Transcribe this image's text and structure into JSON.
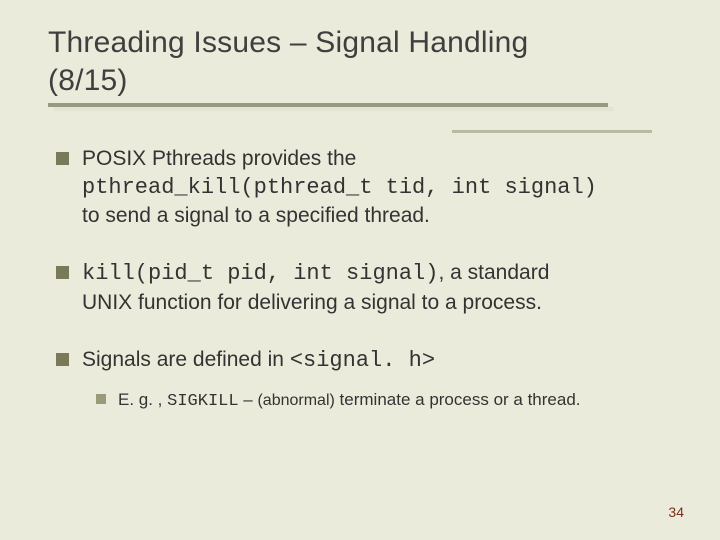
{
  "slide": {
    "title_line1": "Threading Issues – Signal Handling",
    "title_line2": "(8/15)",
    "page_number": "34"
  },
  "bullets": {
    "b1": {
      "lead": "POSIX Pthreads provides the",
      "code": "pthread_kill(pthread_t tid, int signal)",
      "tail": "to send a signal to a specified thread."
    },
    "b2": {
      "code": "kill(pid_t pid, int signal)",
      "mid": ", a standard",
      "tail": "UNIX function for delivering a signal to a process."
    },
    "b3": {
      "lead": "Signals are defined in ",
      "code": "<signal. h>"
    },
    "sub1": {
      "lead": "E. g. , ",
      "code": "SIGKILL",
      "dash": " – ",
      "paren": "(abnormal)",
      "tail": " terminate a process or a thread."
    }
  }
}
